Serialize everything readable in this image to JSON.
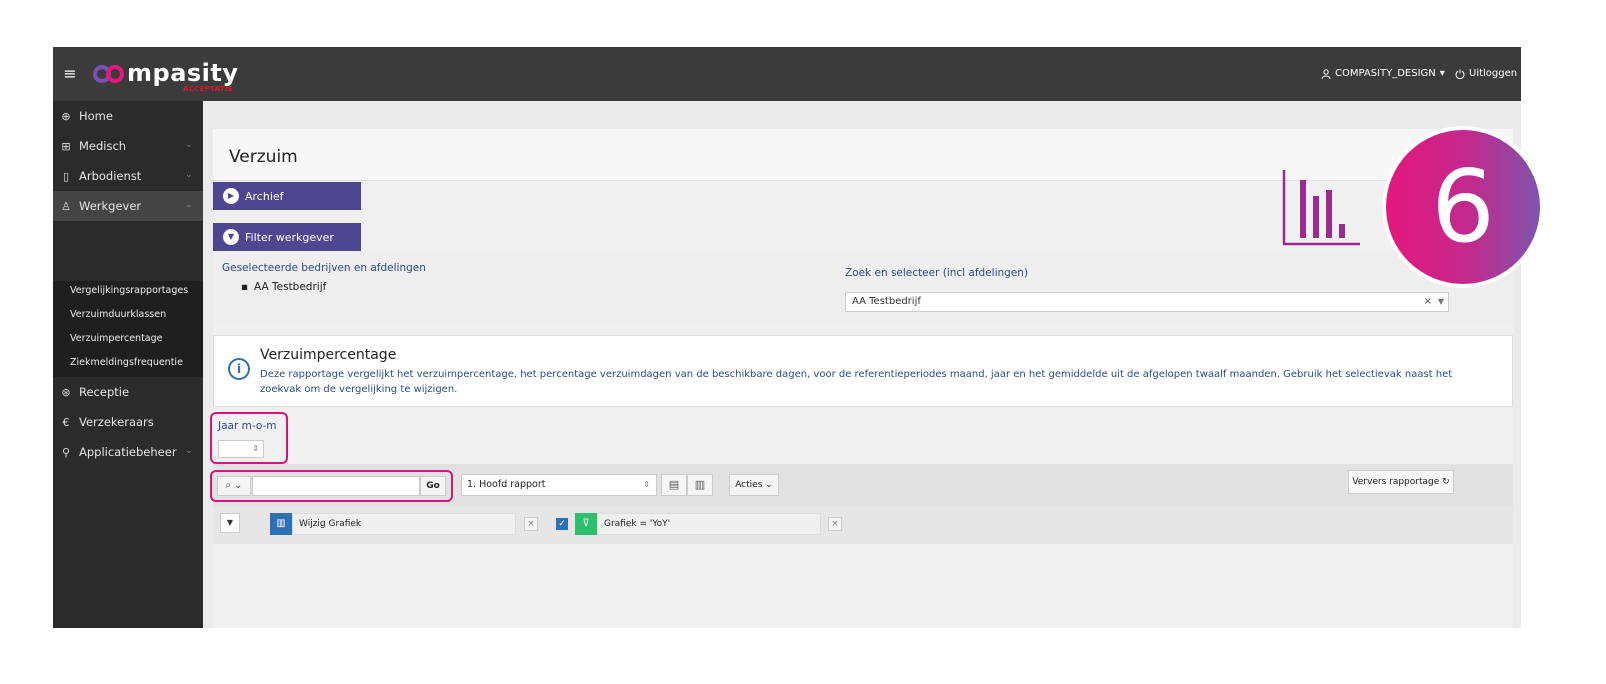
{
  "header": {
    "logo_text": "mpasity",
    "logo_sub": "ACCEPTATIE",
    "user": "COMPASITY_DESIGN",
    "logout": "Uitloggen"
  },
  "sidebar": {
    "items": [
      {
        "label": "Home",
        "icon": "home-icon"
      },
      {
        "label": "Medisch",
        "icon": "medical-icon"
      },
      {
        "label": "Arbodienst",
        "icon": "clipboard-icon"
      },
      {
        "label": "Werkgever",
        "icon": "user-icon"
      },
      {
        "label": "Receptie",
        "icon": "reception-icon"
      },
      {
        "label": "Verzekeraars",
        "icon": "euro-icon"
      },
      {
        "label": "Applicatiebeheer",
        "icon": "admin-icon"
      }
    ],
    "subitems": [
      "Vergelijkingsrapportages",
      "Verzuimduurklassen",
      "Verzuimpercentage",
      "Ziekmeldingsfrequentie"
    ]
  },
  "page": {
    "title": "Verzuim",
    "archive_label": "Archief",
    "filter_label": "Filter werkgever",
    "selected_label": "Geselecteerde bedrijven en afdelingen",
    "selected_value": "AA Testbedrijf",
    "search_label": "Zoek en selecteer (incl afdelingen)",
    "search_value": "AA Testbedrijf"
  },
  "info": {
    "title": "Verzuimpercentage",
    "text": "Deze rapportage vergelijkt het verzuimpercentage, het percentage verzuimdagen van de beschikbare dagen, voor de referentieperiodes maand, jaar en het gemiddelde uit de afgelopen twaalf maanden. Gebruik het selectievak naast het zoekvak om de vergelijking te wijzigen."
  },
  "report": {
    "year_label": "Jaar m-o-m",
    "go_label": "Go",
    "report_select": "1. Hoofd rapport",
    "actions_label": "Acties",
    "refresh_label": "Ververs rapportage",
    "chip_chart": "Wijzig Grafiek",
    "chip_filter": "Grafiek = 'YoY'"
  },
  "badge": {
    "number": "6"
  },
  "colors": {
    "accent": "#4f4692",
    "highlight": "#d4177e",
    "link": "#2c4a86"
  }
}
